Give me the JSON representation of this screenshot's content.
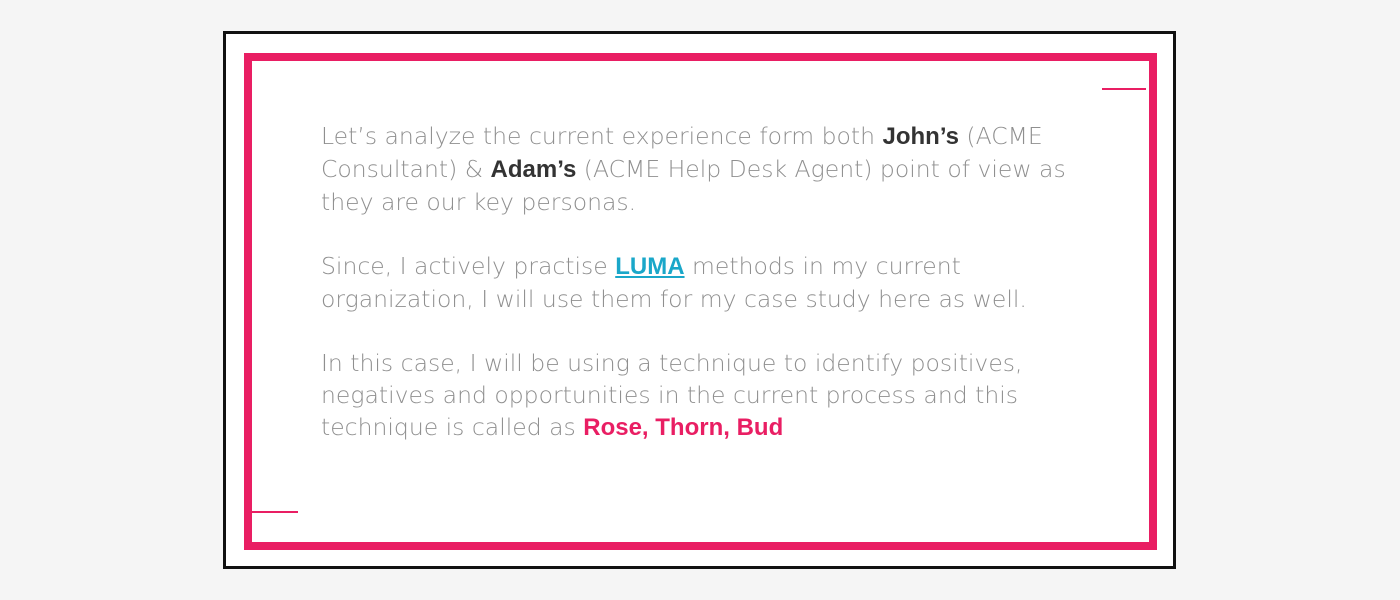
{
  "colors": {
    "accent": "#e91e63",
    "link": "#1aa7c9",
    "text": "#8f8f8f",
    "strong_text": "#333333",
    "frame": "#111111"
  },
  "paragraph_1": {
    "t1": "Let’s analyze the current experience form both ",
    "john": "John’s",
    "t2": "  (ACME Consultant) & ",
    "adam": "Adam’s",
    "t3": " (ACME Help Desk Agent) point of view as they are our key personas."
  },
  "paragraph_2": {
    "t1": "Since, I actively practise  ",
    "luma_link": "LUMA",
    "t2": " methods in my current organization, I will use them for my case study here as well."
  },
  "paragraph_3": {
    "t1": "In this case, I will be using a technique to identify positives, negatives and opportunities in the current process and this technique is called as ",
    "technique": "Rose, Thorn, Bud"
  }
}
